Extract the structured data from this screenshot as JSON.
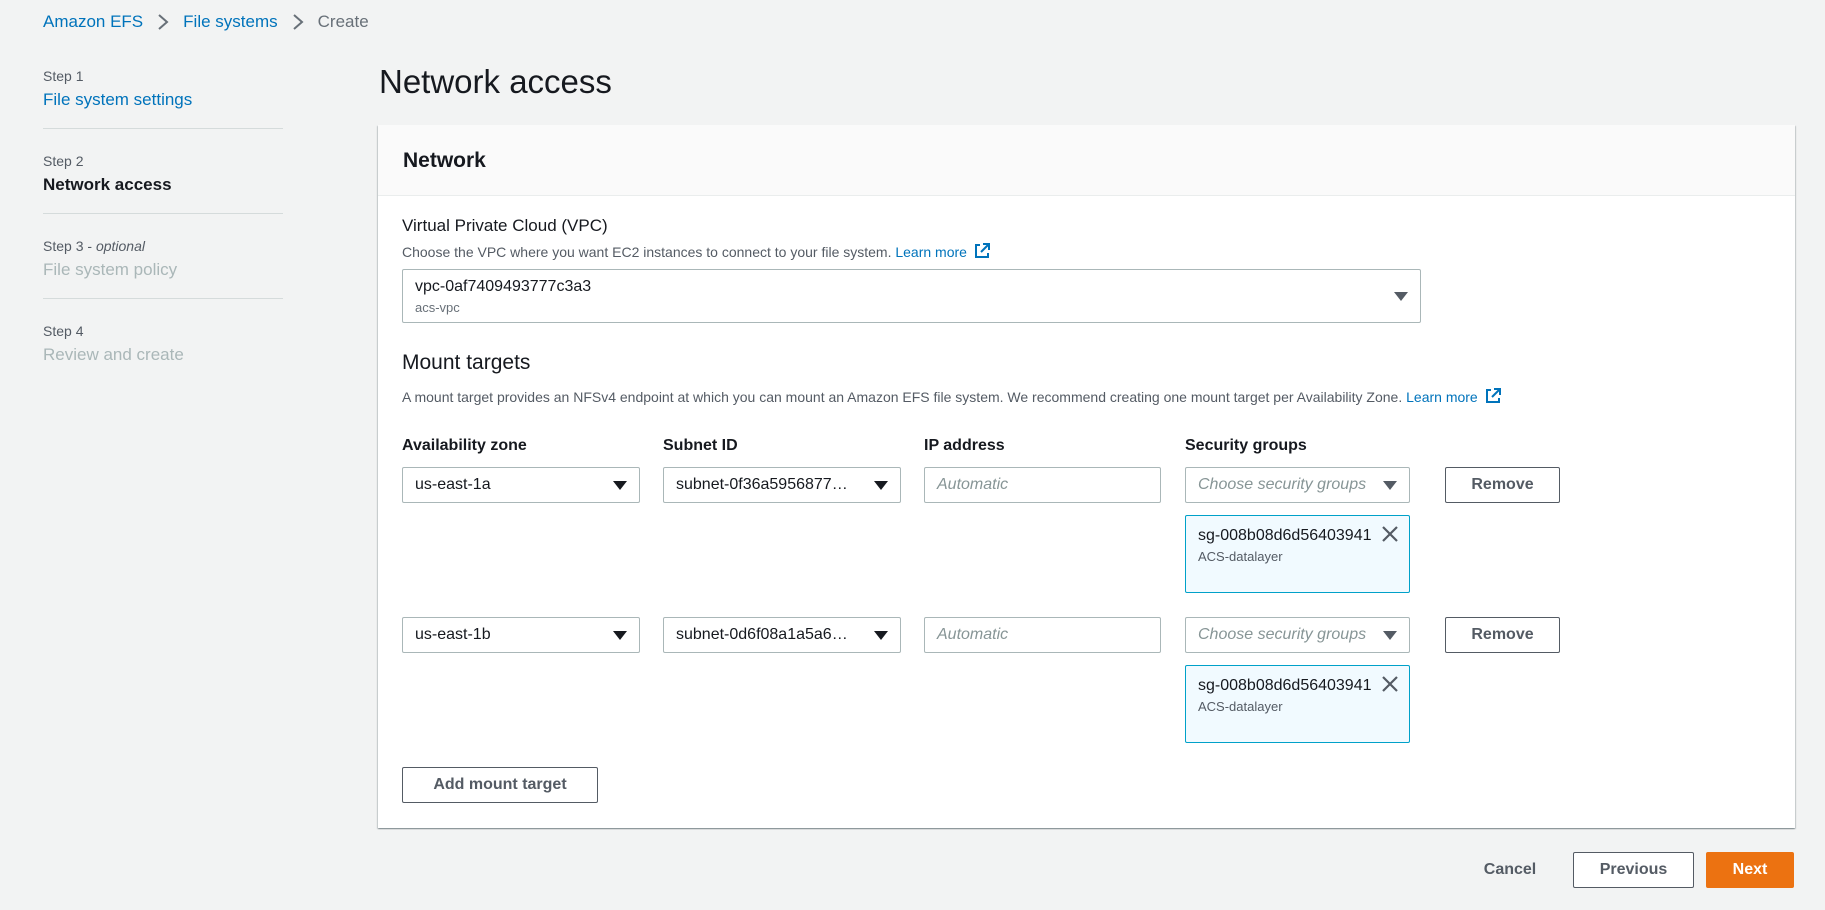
{
  "breadcrumb": {
    "items": [
      "Amazon EFS",
      "File systems",
      "Create"
    ]
  },
  "steps": [
    {
      "num": "Step 1",
      "title": "File system settings"
    },
    {
      "num": "Step 2",
      "title": "Network access"
    },
    {
      "num": "Step 3",
      "optional": "optional",
      "title": "File system policy"
    },
    {
      "num": "Step 4",
      "title": "Review and create"
    }
  ],
  "page_title": "Network access",
  "network": {
    "header": "Network",
    "vpc_label": "Virtual Private Cloud (VPC)",
    "vpc_desc": "Choose the VPC where you want EC2 instances to connect to your file system.",
    "learn_more": "Learn more",
    "vpc_value": "vpc-0af7409493777c3a3",
    "vpc_name": "acs-vpc"
  },
  "mount_targets": {
    "title": "Mount targets",
    "desc": "A mount target provides an NFSv4 endpoint at which you can mount an Amazon EFS file system. We recommend creating one mount target per Availability Zone.",
    "learn_more": "Learn more",
    "columns": {
      "az": "Availability zone",
      "subnet": "Subnet ID",
      "ip": "IP address",
      "sg": "Security groups"
    },
    "ip_placeholder": "Automatic",
    "sg_placeholder": "Choose security groups",
    "remove_label": "Remove",
    "rows": [
      {
        "az": "us-east-1a",
        "subnet": "subnet-0f36a5956877…",
        "sg_id": "sg-008b08d6d56403941",
        "sg_name": "ACS-datalayer"
      },
      {
        "az": "us-east-1b",
        "subnet": "subnet-0d6f08a1a5a6…",
        "sg_id": "sg-008b08d6d56403941",
        "sg_name": "ACS-datalayer"
      }
    ],
    "add_label": "Add mount target"
  },
  "footer": {
    "cancel": "Cancel",
    "previous": "Previous",
    "next": "Next"
  },
  "colors": {
    "link": "#0073bb",
    "primary": "#ec7211",
    "token_border": "#00a1c9",
    "token_bg": "#f1faff"
  }
}
